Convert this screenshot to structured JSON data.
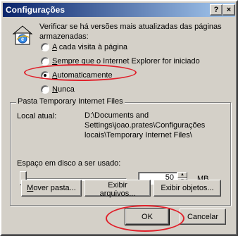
{
  "window": {
    "title": "Configurações",
    "help_button": "?",
    "close_button": "×"
  },
  "intro_text": "Verificar se há versões mais atualizadas das páginas armazenadas:",
  "options": [
    {
      "label": "A cada visita à página",
      "checked": false
    },
    {
      "label": "Sempre que o Internet Explorer for iniciado",
      "checked": false
    },
    {
      "label": "Automaticamente",
      "checked": true
    },
    {
      "label": "Nunca",
      "checked": false
    }
  ],
  "temp_files": {
    "group_title": "Pasta Temporary Internet Files",
    "location_label": "Local atual:",
    "location_lines": [
      "D:\\Documents and",
      "Settings\\joao.prates\\Configurações",
      "locais\\Temporary Internet Files\\"
    ],
    "disk_space_label": "Espaço em disco a ser usado:",
    "disk_space_value": "50",
    "disk_space_unit": "MB",
    "move_button": "Mover pasta...",
    "view_files_button": "Exibir arquivos...",
    "view_objects_button": "Exibir objetos..."
  },
  "footer": {
    "ok_button": "OK",
    "cancel_button": "Cancelar"
  },
  "colors": {
    "dialog_face": "#d4d0c8",
    "title_bar": "#0a246a",
    "highlight_oval": "#e0202a"
  },
  "icons": [
    "ie-page-icon",
    "help-icon",
    "close-icon",
    "spin-up-icon",
    "spin-down-icon"
  ]
}
